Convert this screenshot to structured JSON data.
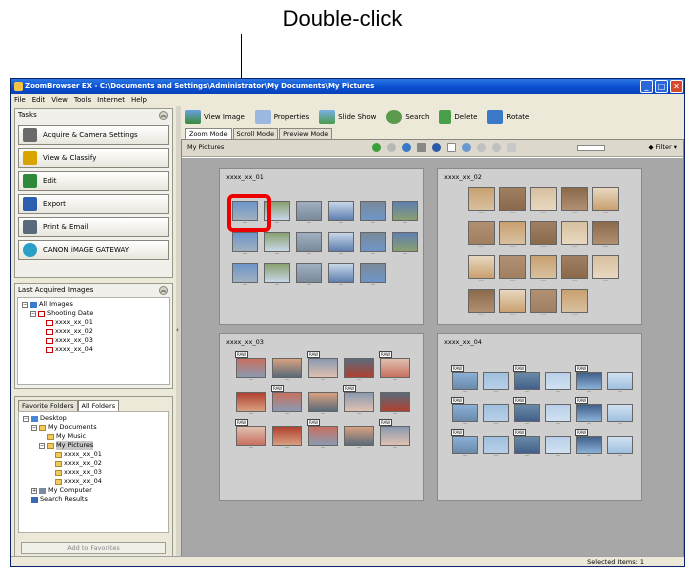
{
  "caption": "Double-click",
  "window": {
    "title": "ZoomBrowser EX  -  C:\\Documents and Settings\\Administrator\\My Documents\\My Pictures"
  },
  "menu": [
    "File",
    "Edit",
    "View",
    "Tools",
    "Internet",
    "Help"
  ],
  "tasks": {
    "title": "Tasks",
    "items": [
      {
        "label": "Acquire & Camera Settings",
        "icon": "camera-icon",
        "color": "#6a6a6a"
      },
      {
        "label": "View & Classify",
        "icon": "view-classify-icon",
        "color": "#d9a400"
      },
      {
        "label": "Edit",
        "icon": "edit-icon",
        "color": "#2d8a3a"
      },
      {
        "label": "Export",
        "icon": "export-icon",
        "color": "#2d5fb0"
      },
      {
        "label": "Print & Email",
        "icon": "print-icon",
        "color": "#5a6a7a"
      },
      {
        "label": "CANON iMAGE GATEWAY",
        "icon": "gateway-icon",
        "color": "#2aa0c8"
      }
    ]
  },
  "last_acquired": {
    "title": "Last Acquired Images",
    "all": "All Images",
    "shooting_date": "Shooting Date",
    "items": [
      "xxxx_xx_01",
      "xxxx_xx_02",
      "xxxx_xx_03",
      "xxxx_xx_04"
    ]
  },
  "folders": {
    "tabs": [
      "Favorite Folders",
      "All Folders"
    ],
    "desktop": "Desktop",
    "my_documents": "My Documents",
    "my_music": "My Music",
    "my_pictures": "My Pictures",
    "sub": [
      "xxxx_xx_01",
      "xxxx_xx_02",
      "xxxx_xx_03",
      "xxxx_xx_04"
    ],
    "my_computer": "My Computer",
    "search_results": "Search Results",
    "add_button": "Add to Favorites"
  },
  "toolbar": [
    "View Image",
    "Properties",
    "Slide Show",
    "Search",
    "Delete",
    "Rotate"
  ],
  "mode_tabs": [
    "Zoom Mode",
    "Scroll Mode",
    "Preview Mode"
  ],
  "path": "My Pictures",
  "filter": "Filter",
  "groups": [
    "xxxx_xx_01",
    "xxxx_xx_02",
    "xxxx_xx_03",
    "xxxx_xx_04"
  ],
  "status": "Selected Items: 1"
}
